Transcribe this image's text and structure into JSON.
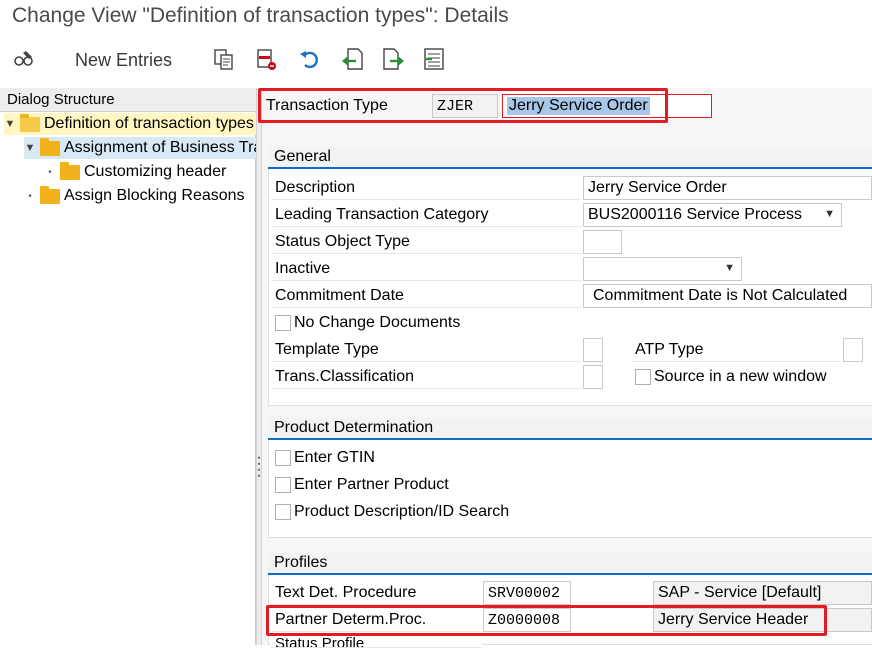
{
  "window": {
    "title": "Change View \"Definition of transaction types\": Details"
  },
  "toolbar": {
    "new_entries_label": "New Entries",
    "icons": [
      "display-change-icon",
      "copy-icon",
      "delete-icon",
      "undo-icon",
      "previous-entry-icon",
      "next-entry-icon",
      "select-all-icon"
    ]
  },
  "sidebar": {
    "title": "Dialog Structure",
    "items": [
      {
        "label": "Definition of transaction types",
        "level": 0,
        "expanded": true,
        "selected": true
      },
      {
        "label": "Assignment of Business Transaction Categories",
        "level": 1,
        "expanded": true,
        "selected": false
      },
      {
        "label": "Customizing header",
        "level": 2,
        "expanded": false,
        "selected": false
      },
      {
        "label": "Assign Blocking Reasons",
        "level": 0,
        "expanded": false,
        "selected": false
      }
    ]
  },
  "header": {
    "transaction_type_label": "Transaction Type",
    "transaction_type_code": "ZJER",
    "transaction_type_name": "Jerry Service Order"
  },
  "general": {
    "title": "General",
    "description_label": "Description",
    "description_value": "Jerry Service Order",
    "leading_category_label": "Leading Transaction Category",
    "leading_category_value": "BUS2000116 Service Process",
    "status_object_type_label": "Status Object Type",
    "status_object_type_value": "",
    "inactive_label": "Inactive",
    "inactive_value": "",
    "commitment_date_label": "Commitment Date",
    "commitment_date_value": "Commitment Date is Not Calculated",
    "no_change_documents_label": "No Change Documents",
    "template_type_label": "Template Type",
    "atp_type_label": "ATP Type",
    "trans_classification_label": "Trans.Classification",
    "source_new_window_label": "Source in a new window"
  },
  "product_determination": {
    "title": "Product Determination",
    "enter_gtin_label": "Enter GTIN",
    "enter_partner_product_label": "Enter Partner Product",
    "product_desc_search_label": "Product Description/ID Search"
  },
  "profiles": {
    "title": "Profiles",
    "text_det_label": "Text Det. Procedure",
    "text_det_code": "SRV00002",
    "text_det_desc": "SAP - Service [Default]",
    "partner_det_label": "Partner Determ.Proc.",
    "partner_det_code": "Z0000008",
    "partner_det_desc": "Jerry Service Header",
    "status_profile_label": "Status Profile"
  },
  "colors": {
    "highlight_red": "#e31b23",
    "folder_yellow": "#f2b21c",
    "selection_blue": "#d9e8f5",
    "section_rule_blue": "#0a6ed1"
  }
}
